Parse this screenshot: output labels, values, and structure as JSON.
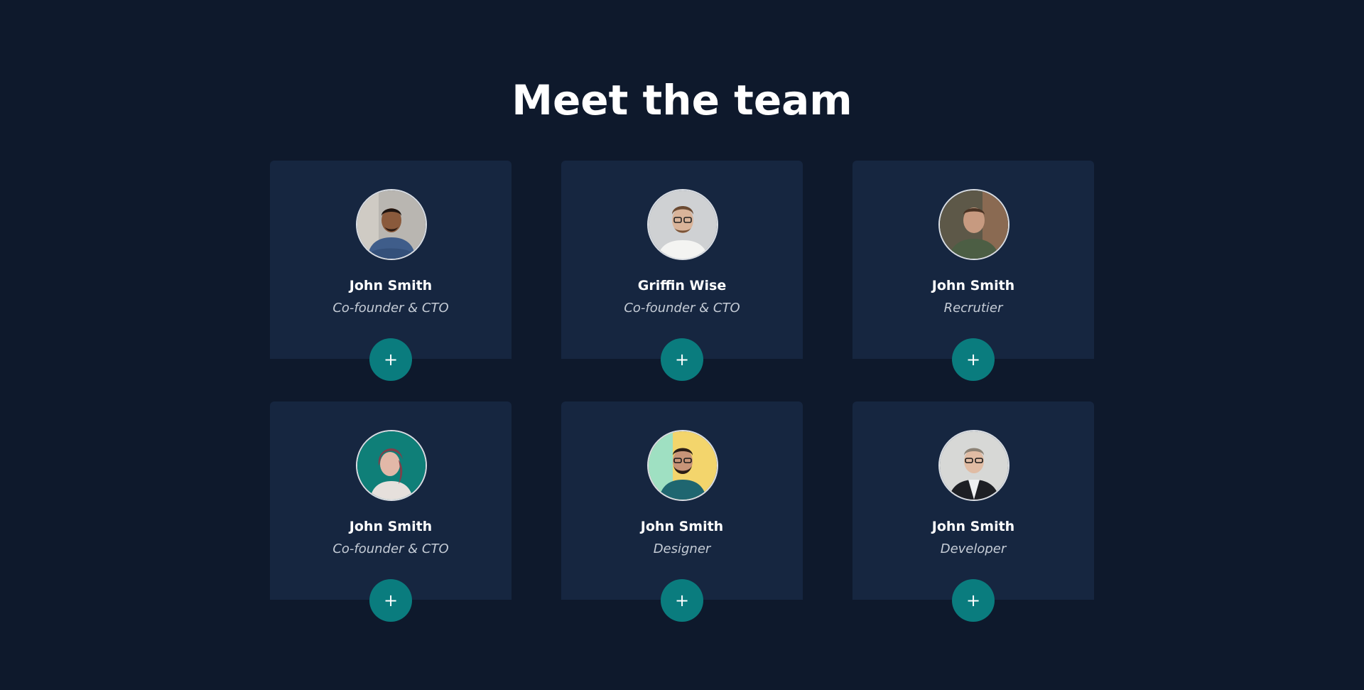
{
  "page": {
    "title": "Meet the team"
  },
  "colors": {
    "background": "#0e192c",
    "card": "#162640",
    "accent": "#0a7c7e",
    "name": "#ffffff",
    "role": "#c5ccd6"
  },
  "team": [
    {
      "name": "John Smith",
      "role": "Co-founder & CTO",
      "button_label": "+",
      "avatar_icon": "person-photo-icon"
    },
    {
      "name": "Griffin Wise",
      "role": "Co-founder & CTO",
      "button_label": "+",
      "avatar_icon": "person-photo-icon"
    },
    {
      "name": "John Smith",
      "role": "Recrutier",
      "button_label": "+",
      "avatar_icon": "person-photo-icon"
    },
    {
      "name": "John Smith",
      "role": "Co-founder & CTO",
      "button_label": "+",
      "avatar_icon": "person-photo-icon"
    },
    {
      "name": "John Smith",
      "role": "Designer",
      "button_label": "+",
      "avatar_icon": "person-photo-icon"
    },
    {
      "name": "John Smith",
      "role": "Developer",
      "button_label": "+",
      "avatar_icon": "person-photo-icon"
    }
  ]
}
